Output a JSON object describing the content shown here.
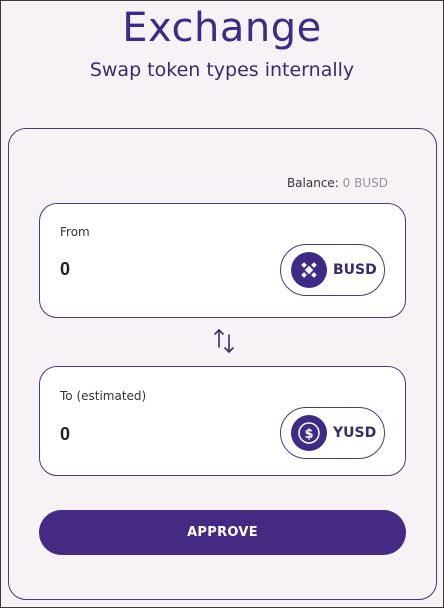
{
  "header": {
    "title": "Exchange",
    "subtitle": "Swap token types internally"
  },
  "balance": {
    "label": "Balance:",
    "value": "0 BUSD"
  },
  "from": {
    "label": "From",
    "amount": "0",
    "token": "BUSD",
    "token_icon": "busd-icon"
  },
  "swap_icon": "swap-arrows-icon",
  "to": {
    "label": "To (estimated)",
    "amount": "0",
    "token": "YUSD",
    "token_icon": "yusd-icon"
  },
  "approve_label": "APPROVE",
  "colors": {
    "accent": "#452a84",
    "title": "#3f2a86",
    "background": "#f7f2f5"
  }
}
